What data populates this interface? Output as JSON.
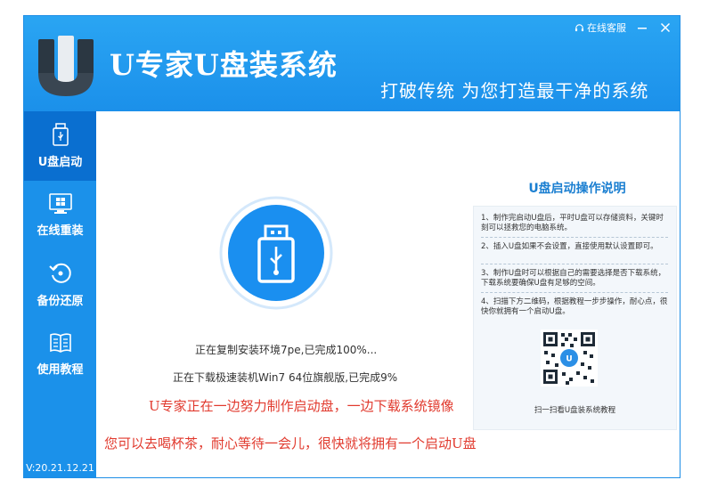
{
  "header": {
    "app_title": "U专家U盘装系统",
    "slogan": "打破传统 为您打造最干净的系统",
    "service_label": "在线客服"
  },
  "sidebar": {
    "items": [
      {
        "label": "U盘启动",
        "icon": "usb-drive-icon",
        "active": true
      },
      {
        "label": "在线重装",
        "icon": "monitor-windows-icon",
        "active": false
      },
      {
        "label": "备份还原",
        "icon": "restore-icon",
        "active": false
      },
      {
        "label": "使用教程",
        "icon": "book-icon",
        "active": false
      }
    ],
    "version": "V:20.21.12.21"
  },
  "main": {
    "status_copy": "正在复制安装环境7pe,已完成100%...",
    "status_download": "正在下载极速装机Win7 64位旗舰版,已完成9%",
    "notice_1": "U专家正在一边努力制作启动盘，一边下载系统镜像",
    "notice_2": "您可以去喝杯茶，耐心等待一会儿，很快就将拥有一个启动U盘"
  },
  "guide": {
    "title": "U盘启动操作说明",
    "steps": [
      "1、制作完启动U盘后，平时U盘可以存储资料，关键时刻可以拯救您的电脑系统。",
      "2、插入U盘如果不会设置，直接使用默认设置即可。",
      "3、制作U盘时可以根据自己的需要选择是否下载系统，下载系统要确保U盘有足够的空间。",
      "4、扫描下方二维码，根据教程一步步操作，耐心点，很快你就拥有一个启动U盘。"
    ],
    "qr_caption": "扫一扫看U盘装系统教程"
  },
  "colors": {
    "accent": "#1b91ea",
    "sidebar_active": "#0a6fd0",
    "notice": "#e13a2e",
    "guide_title": "#1b7fd1"
  }
}
